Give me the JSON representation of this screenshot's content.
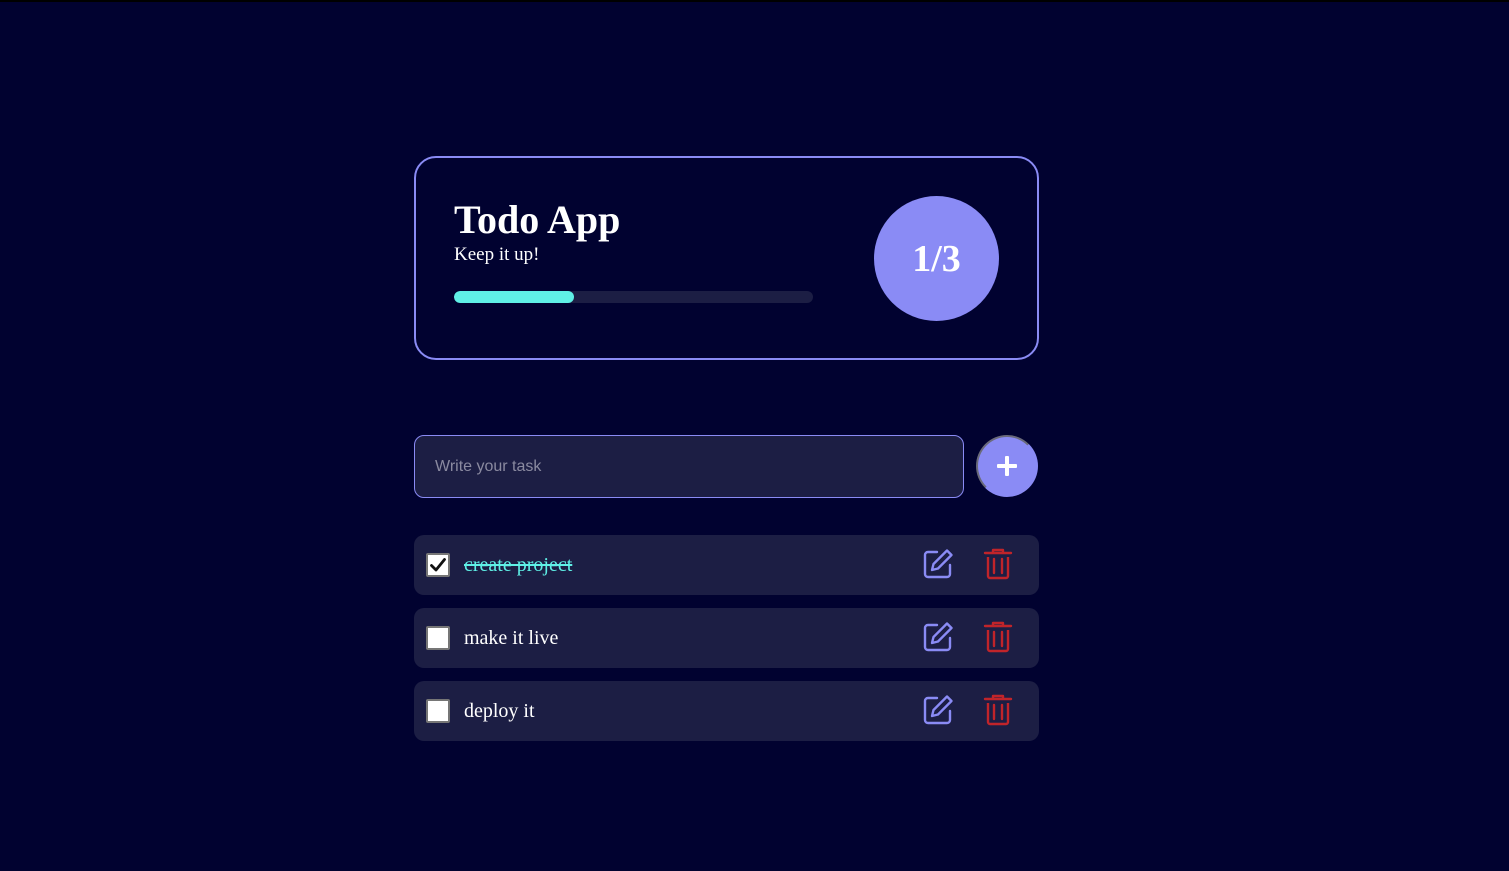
{
  "colors": {
    "background": "#010230",
    "accent": "#8a8bf5",
    "progress": "#5ff0e6",
    "card": "#1c1e44",
    "delete": "#c0242a"
  },
  "header": {
    "title": "Todo App",
    "subtitle": "Keep it up!",
    "progress_fraction": 0.3333,
    "counter": "1/3"
  },
  "form": {
    "placeholder": "Write your task",
    "value": "",
    "add_icon": "plus-icon"
  },
  "todos": [
    {
      "text": "create project",
      "done": true
    },
    {
      "text": "make it live",
      "done": false
    },
    {
      "text": "deploy it",
      "done": false
    }
  ],
  "icons": {
    "edit": "edit-icon",
    "delete": "trash-icon",
    "check": "check-icon"
  }
}
